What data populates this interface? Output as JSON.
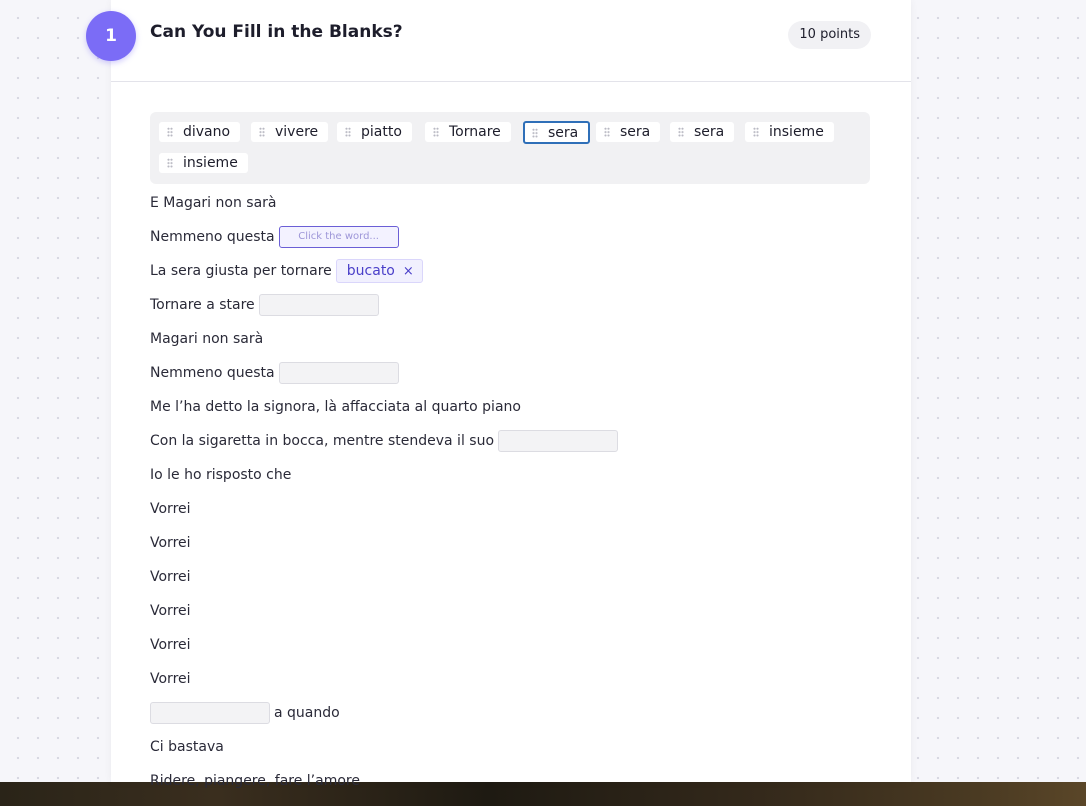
{
  "question": {
    "number": "1",
    "title": "Can You Fill in the Blanks?",
    "points": "10 points"
  },
  "word_bank": [
    "divano",
    "vivere",
    "piatto",
    "Tornare",
    "sera",
    "sera",
    "sera",
    "insieme",
    "insieme"
  ],
  "selected_word_index": 4,
  "lines": {
    "l1": "E Magari non sarà",
    "l2": "Nemmeno questa",
    "l2_placeholder": "Click the word...",
    "l3": "La sera giusta per tornare",
    "l3_filled": "bucato",
    "l3_remove": "×",
    "l4": "Tornare a stare",
    "l5": "Magari non sarà",
    "l6": "Nemmeno questa",
    "l7": "Me l’ha detto la signora, là affacciata al quarto piano",
    "l8": "Con la sigaretta in bocca, mentre stendeva il suo",
    "l9": "Io le ho risposto che",
    "l10": "Vorrei",
    "l11": "Vorrei",
    "l12": "Vorrei",
    "l13": "Vorrei",
    "l14": "Vorrei",
    "l15": "Vorrei",
    "l16": "a quando",
    "l17": "Ci bastava",
    "l18": "Ridere, piangere, fare l’amore"
  },
  "colors": {
    "accent": "#7b6cf6",
    "selected_border": "#2f6fb8",
    "filled_text": "#4a3fc9"
  }
}
